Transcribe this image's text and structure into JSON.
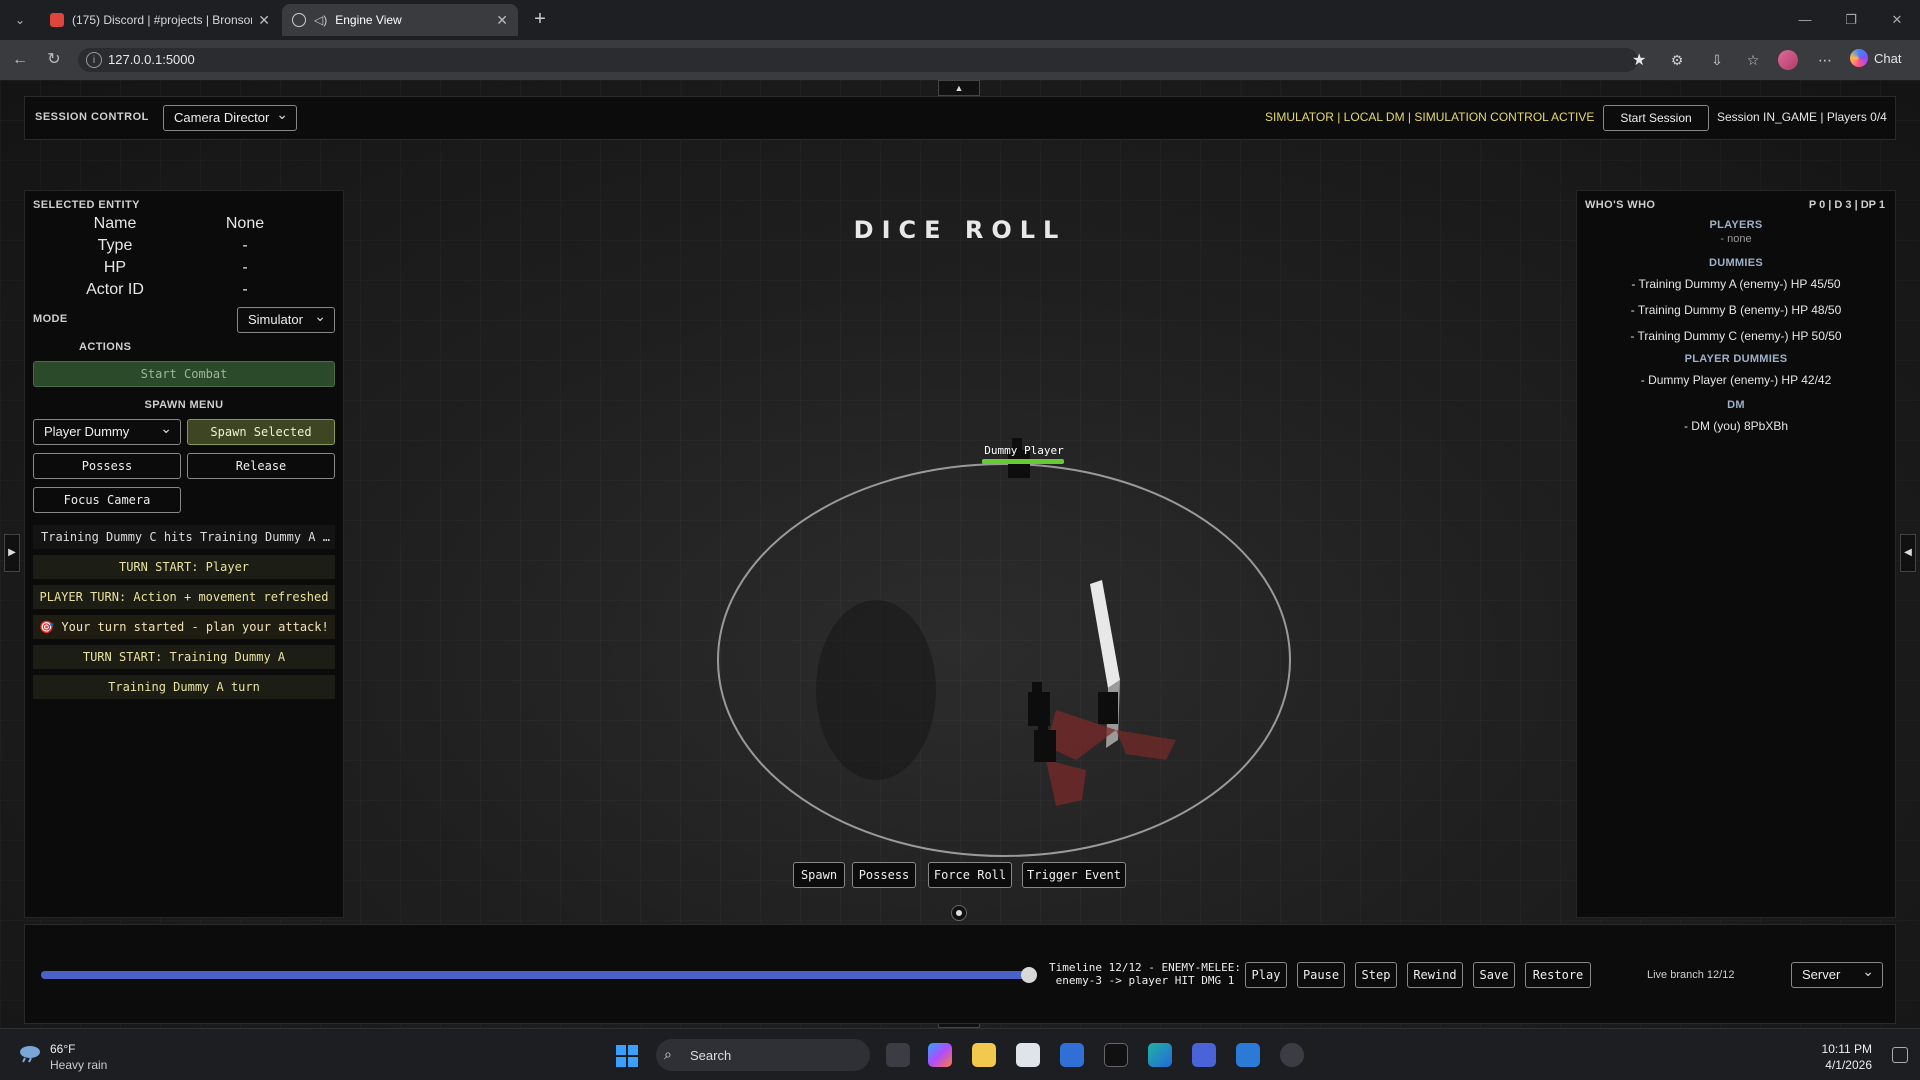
{
  "browser": {
    "tabs": [
      {
        "title": "(175) Discord | #projects | Bronson",
        "favicon_color": "#e0453d"
      },
      {
        "title": "Engine View",
        "favicon_color": "#cfcfcf"
      }
    ],
    "new_tab_icon": "plus-icon",
    "url": "127.0.0.1:5000",
    "chat_label": "Chat"
  },
  "session": {
    "label": "SESSION CONTROL",
    "camera_mode": "Camera Director",
    "status": "SIMULATOR | LOCAL DM | SIMULATION CONTROL ACTIVE",
    "start_button": "Start Session",
    "info": "Session IN_GAME | Players 0/4",
    "status_color": "#e5d86a"
  },
  "left_panel": {
    "heading": "SELECTED ENTITY",
    "fields": [
      {
        "label": "Name",
        "value": "None"
      },
      {
        "label": "Type",
        "value": "-"
      },
      {
        "label": "HP",
        "value": "-"
      },
      {
        "label": "Actor ID",
        "value": "-"
      }
    ],
    "mode_label": "MODE",
    "mode_value": "Simulator",
    "actions_label": "ACTIONS",
    "start_combat": "Start Combat",
    "spawn_menu_label": "SPAWN MENU",
    "spawn_type": "Player Dummy",
    "spawn_selected": "Spawn Selected",
    "possess": "Possess",
    "release": "Release",
    "focus_camera": "Focus Camera",
    "log": [
      "Training Dummy C hits Training Dummy A for…",
      "TURN START: Player",
      "PLAYER TURN: Action + movement refreshed",
      "🎯 Your turn started - plan your attack!",
      "TURN START: Training Dummy A",
      "Training Dummy A turn"
    ]
  },
  "scene": {
    "title": "DICE ROLL",
    "player_nameplate": "Dummy Player",
    "buttons": {
      "spawn": "Spawn",
      "possess": "Possess",
      "force_roll": "Force Roll",
      "trigger_event": "Trigger Event"
    }
  },
  "right_panel": {
    "heading": "WHO'S WHO",
    "stats": "P 0 | D 3 | DP 1",
    "players_heading": "PLAYERS",
    "players_none": "- none",
    "dummies_heading": "DUMMIES",
    "dummies": [
      "- Training Dummy A (enemy-) HP 45/50",
      "- Training Dummy B (enemy-) HP 48/50",
      "- Training Dummy C (enemy-) HP 50/50"
    ],
    "player_dummies_heading": "PLAYER DUMMIES",
    "player_dummies": [
      "- Dummy Player (enemy-) HP 42/42"
    ],
    "dm_heading": "DM",
    "dm": [
      "- DM (you) 8PbXBh"
    ]
  },
  "timeline": {
    "progress": 1.0,
    "line1": "Timeline 12/12 - ENEMY-MELEE:",
    "line2": "enemy-3 -> player HIT DMG 1",
    "buttons": [
      "Play",
      "Pause",
      "Step",
      "Rewind",
      "Save",
      "Restore"
    ],
    "live_branch": "Live branch 12/12",
    "server": "Server"
  },
  "taskbar": {
    "temp": "66°F",
    "weather": "Heavy rain",
    "search": "Search",
    "time": "10:11 PM",
    "date": "4/1/2026"
  }
}
